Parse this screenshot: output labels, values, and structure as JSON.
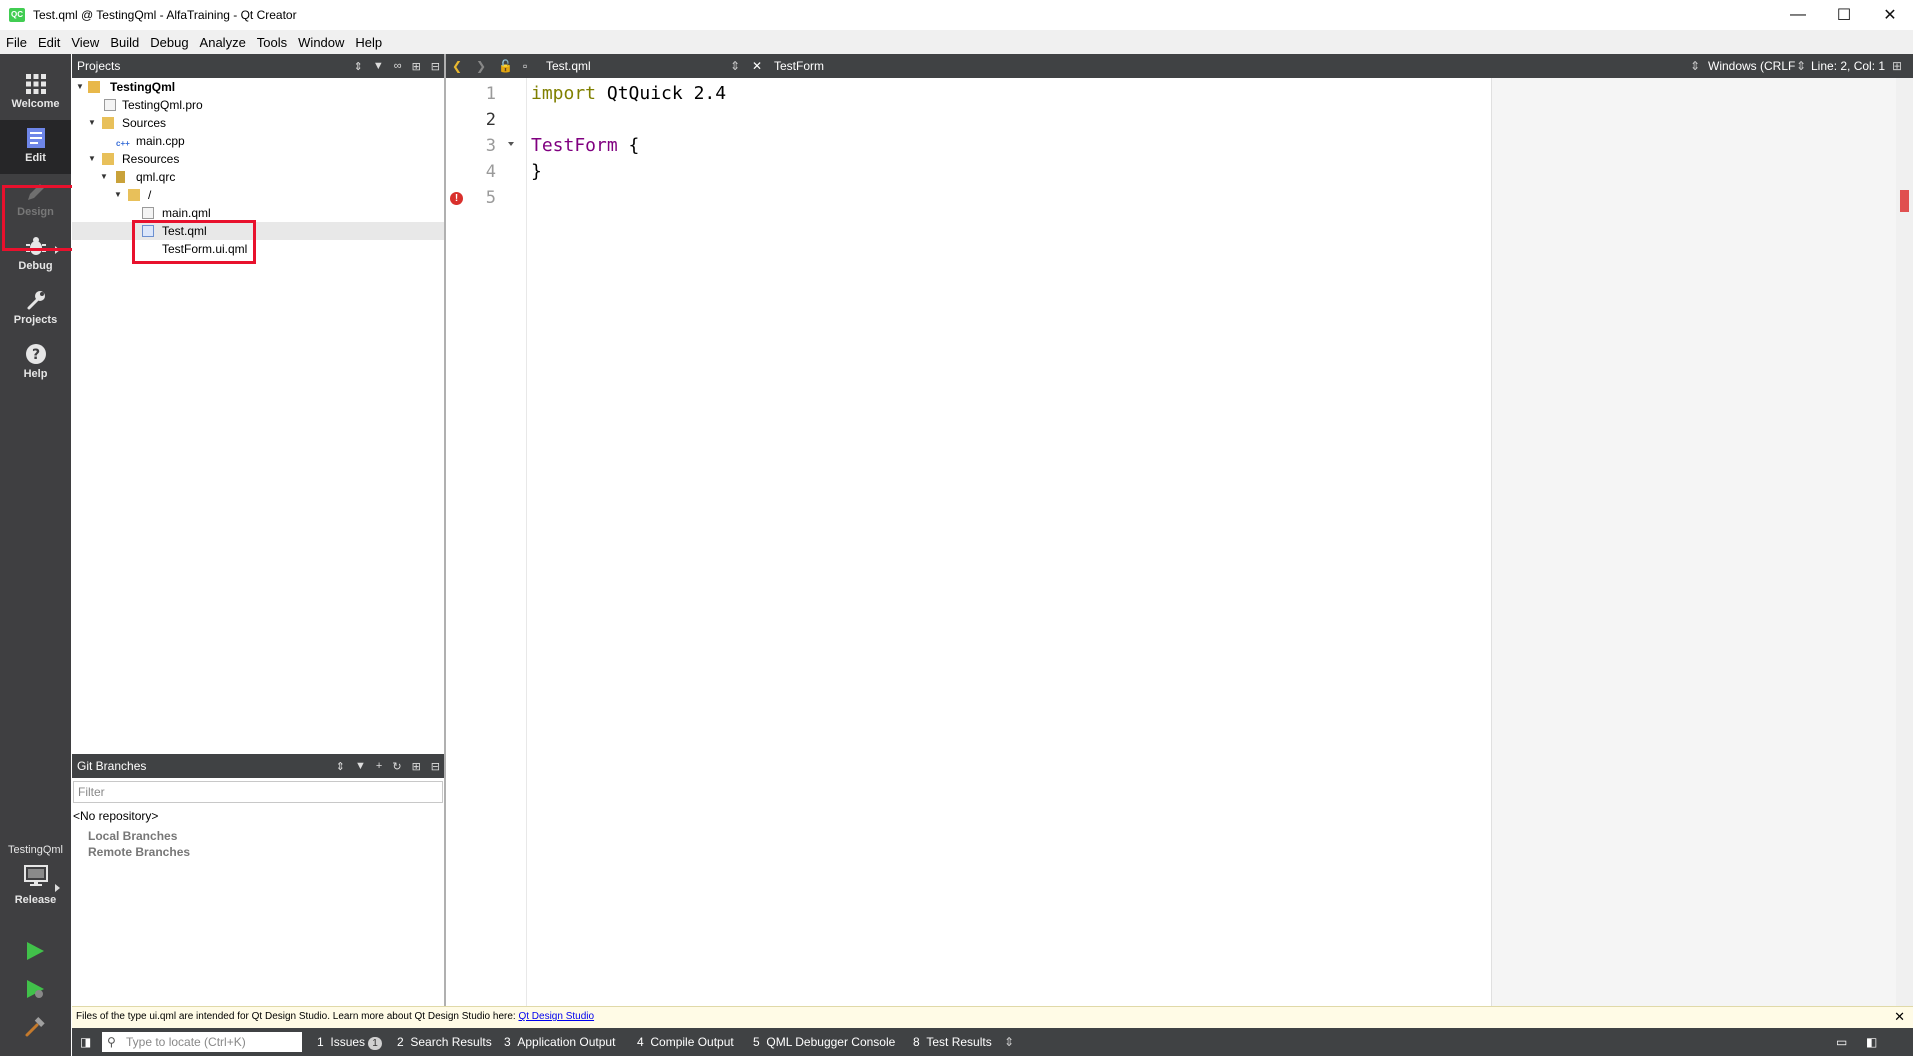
{
  "window": {
    "title": "Test.qml @ TestingQml - AlfaTraining - Qt Creator",
    "app_icon": "QC",
    "controls": {
      "minimize": "—",
      "maximize": "☐",
      "close": "✕"
    }
  },
  "menu": [
    "File",
    "Edit",
    "View",
    "Build",
    "Debug",
    "Analyze",
    "Tools",
    "Window",
    "Help"
  ],
  "modes": [
    {
      "label": "Welcome",
      "icon": "grid-icon",
      "state": "normal"
    },
    {
      "label": "Edit",
      "icon": "document-icon",
      "state": "active"
    },
    {
      "label": "Design",
      "icon": "pencil-icon",
      "state": "disabled"
    },
    {
      "label": "Debug",
      "icon": "bug-icon",
      "state": "normal"
    },
    {
      "label": "Projects",
      "icon": "wrench-icon",
      "state": "normal"
    },
    {
      "label": "Help",
      "icon": "help-icon",
      "state": "normal"
    }
  ],
  "kit": {
    "project": "TestingQml",
    "config": "Release"
  },
  "projects_pane": {
    "title": "Projects",
    "tree": [
      {
        "label": "TestingQml",
        "bold": true
      },
      {
        "label": "TestingQml.pro"
      },
      {
        "label": "Sources"
      },
      {
        "label": "main.cpp"
      },
      {
        "label": "Resources"
      },
      {
        "label": "qml.qrc"
      },
      {
        "label": "/"
      },
      {
        "label": "main.qml"
      },
      {
        "label": "Test.qml",
        "selected": true
      },
      {
        "label": "TestForm.ui.qml"
      }
    ]
  },
  "git_pane": {
    "title": "Git Branches",
    "filter_placeholder": "Filter",
    "repo": "<No repository>",
    "local": "Local Branches",
    "remote": "Remote Branches"
  },
  "editor": {
    "file": "Test.qml",
    "symbol": "TestForm",
    "line_ending": "Windows (CRLF",
    "position": "Line: 2, Col: 1",
    "line_numbers": [
      "1",
      "2",
      "3",
      "4",
      "5"
    ],
    "code": {
      "l1_kw": "import",
      "l1_rest": " QtQuick 2.4",
      "l3_type": "TestForm",
      "l3_rest": " {",
      "l4": "}"
    }
  },
  "infobar": {
    "text": "Files of the type ui.qml are intended for Qt Design Studio. Learn more about Qt Design Studio here: ",
    "link": "Qt Design Studio"
  },
  "status": {
    "locator_placeholder": "Type to locate (Ctrl+K)",
    "tabs": [
      {
        "num": "1",
        "label": "Issues",
        "badge": "1"
      },
      {
        "num": "2",
        "label": "Search Results"
      },
      {
        "num": "3",
        "label": "Application Output"
      },
      {
        "num": "4",
        "label": "Compile Output"
      },
      {
        "num": "5",
        "label": "QML Debugger Console"
      },
      {
        "num": "8",
        "label": "Test Results"
      }
    ]
  },
  "colors": {
    "highlight": "#e8112d",
    "keyword": "#808000",
    "type": "#800080",
    "sidebar": "#3f3f41",
    "toolbar": "#404244"
  }
}
